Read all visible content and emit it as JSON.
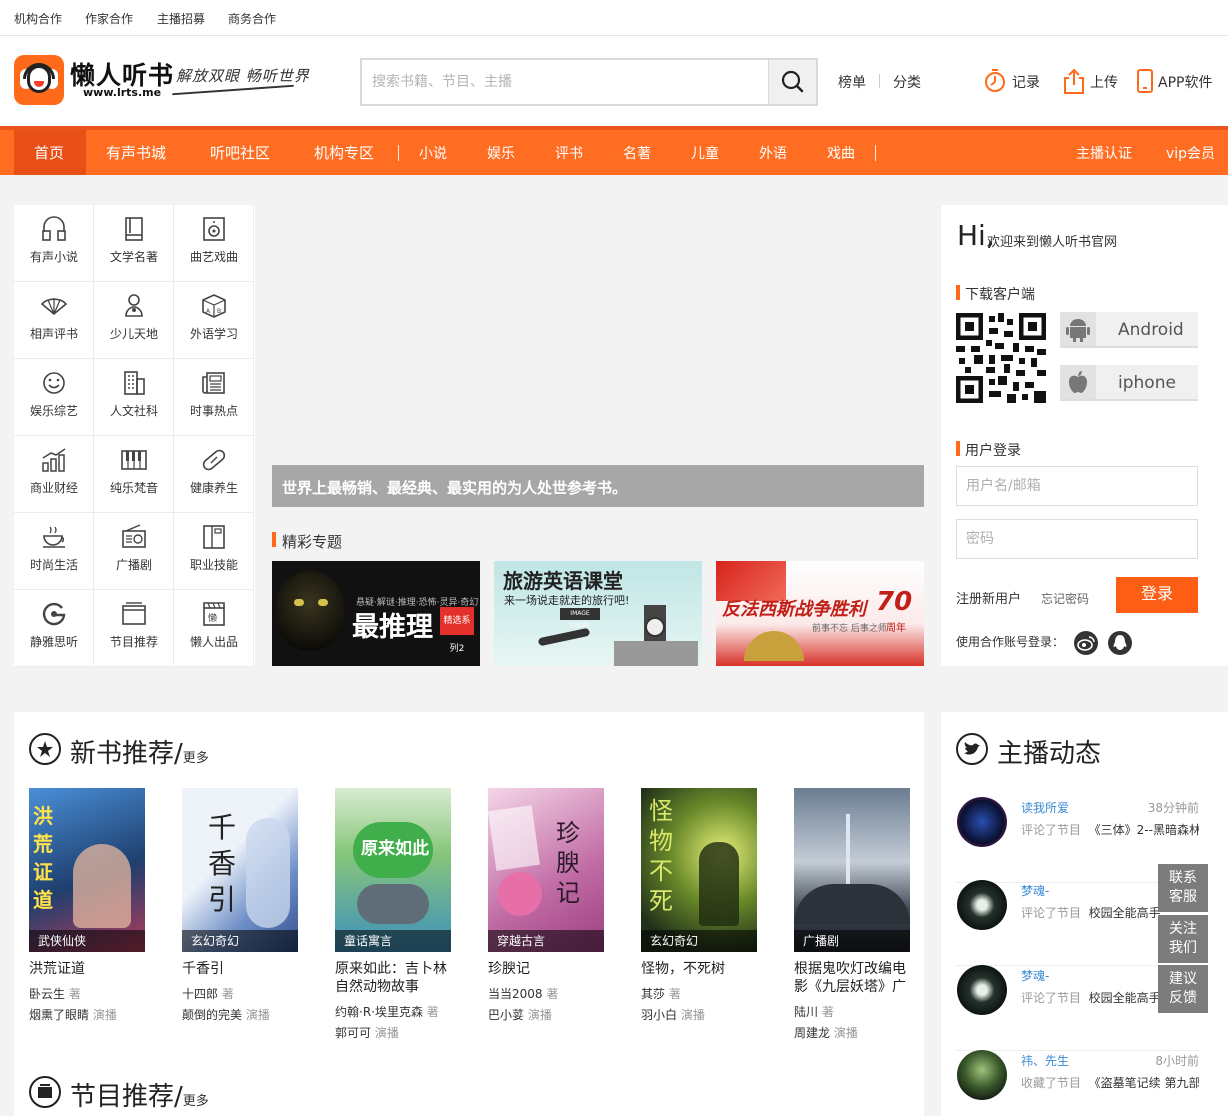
{
  "topbar": {
    "links": [
      "机构合作",
      "作家合作",
      "主播招募",
      "商务合作"
    ]
  },
  "header": {
    "logo_name": "懒人听书",
    "logo_url": "www.lrts.me",
    "slogan": "解放双眼 畅听世界",
    "search_placeholder": "搜索书籍、节目、主播",
    "links": [
      "榜单",
      "分类"
    ],
    "actions": [
      "记录",
      "上传",
      "APP软件"
    ]
  },
  "nav": {
    "main": [
      "首页",
      "有声书城",
      "听吧社区",
      "机构专区"
    ],
    "sub": [
      "小说",
      "娱乐",
      "评书",
      "名著",
      "儿童",
      "外语",
      "戏曲"
    ],
    "right": [
      "主播认证",
      "vip会员"
    ]
  },
  "categories": [
    {
      "label": "有声小说",
      "icon": "headphones-icon"
    },
    {
      "label": "文学名著",
      "icon": "book-icon"
    },
    {
      "label": "曲艺戏曲",
      "icon": "speaker-icon"
    },
    {
      "label": "相声评书",
      "icon": "fan-icon"
    },
    {
      "label": "少儿天地",
      "icon": "baby-icon"
    },
    {
      "label": "外语学习",
      "icon": "abc-cube-icon"
    },
    {
      "label": "娱乐综艺",
      "icon": "smiley-icon"
    },
    {
      "label": "人文社科",
      "icon": "building-icon"
    },
    {
      "label": "时事热点",
      "icon": "newspaper-icon"
    },
    {
      "label": "商业财经",
      "icon": "bar-chart-icon"
    },
    {
      "label": "纯乐梵音",
      "icon": "piano-icon"
    },
    {
      "label": "健康养生",
      "icon": "pill-icon"
    },
    {
      "label": "时尚生活",
      "icon": "coffee-icon"
    },
    {
      "label": "广播剧",
      "icon": "radio-icon"
    },
    {
      "label": "职业技能",
      "icon": "toolbox-icon"
    },
    {
      "label": "静雅思听",
      "icon": "g-logo-icon"
    },
    {
      "label": "节目推荐",
      "icon": "tv-icon"
    },
    {
      "label": "懒人出品",
      "icon": "clapper-icon"
    }
  ],
  "banner": {
    "caption": "世界上最畅销、最经典、最实用的为人处世参考书。"
  },
  "topics": {
    "title": "精彩专题",
    "items": [
      {
        "text": "最推理",
        "badge": "精选系列2",
        "small": "悬疑·解谜·推理·恐怖·灵异·奇幻"
      },
      {
        "text": "旅游英语课堂",
        "sub": "来一场说走就走的旅行吧!",
        "small": "IMAGE TODAY"
      },
      {
        "text": "反法西斯战争胜利",
        "num": "70",
        "sub": "周年",
        "small": "前事不忘 后事之师"
      }
    ]
  },
  "login": {
    "hi": "Hi,",
    "welcome": "欢迎来到懒人听书官网",
    "download_title": "下载客户端",
    "android": "Android",
    "iphone": "iphone",
    "login_title": "用户登录",
    "user_placeholder": "用户名/邮箱",
    "pwd_placeholder": "密码",
    "register": "注册新用户",
    "forgot": "忘记密码",
    "login_btn": "登录",
    "share": "使用合作账号登录："
  },
  "newbooks": {
    "title": "新书推荐/",
    "more": "更多",
    "author_suffix": "著",
    "anchor_suffix": "演播",
    "items": [
      {
        "name": "洪荒证道",
        "tag": "武侠仙侠",
        "author": "卧云生",
        "anchor": "烟熏了眼睛"
      },
      {
        "name": "千香引",
        "tag": "玄幻奇幻",
        "author": "十四郎",
        "anchor": "颠倒的完美"
      },
      {
        "name": "原来如此：吉卜林自然动物故事",
        "tag": "童话寓言",
        "author": "约翰·R·埃里克森",
        "anchor": "郭可可"
      },
      {
        "name": "珍腴记",
        "tag": "穿越古言",
        "author": "当当2008",
        "anchor": "巴小荽"
      },
      {
        "name": "怪物，不死树",
        "tag": "玄幻奇幻",
        "author": "其莎",
        "anchor": "羽小白"
      },
      {
        "name": "根据鬼吹灯改编电影《九层妖塔》广",
        "tag": "广播剧",
        "author": "陆川",
        "anchor": "周建龙"
      }
    ]
  },
  "program": {
    "title": "节目推荐/",
    "more": "更多"
  },
  "anchors": {
    "title": "主播动态",
    "items": [
      {
        "user": "读我所爱",
        "time": "38分钟前",
        "action": "评论了节目",
        "target": "《三体》2--黑暗森林"
      },
      {
        "user": "梦魂-",
        "time": "",
        "action": "评论了节目",
        "target": "校园全能高手"
      },
      {
        "user": "梦魂-",
        "time": "",
        "action": "评论了节目",
        "target": "校园全能高手"
      },
      {
        "user": "祎、先生",
        "time": "8小时前",
        "action": "收藏了节目",
        "target": "《盗墓笔记续 第九部"
      }
    ]
  },
  "float": {
    "service_1": "联系",
    "service_2": "客服",
    "follow_1": "关注",
    "follow_2": "我们",
    "feedback_1": "建议",
    "feedback_2": "反馈"
  },
  "colors": {
    "brand": "#fe6d22",
    "nav_active": "#e85018",
    "login": "#fe5d15",
    "link": "#3a8bd6"
  }
}
